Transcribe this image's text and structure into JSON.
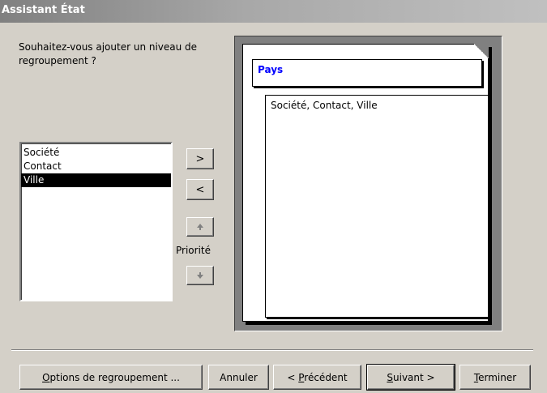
{
  "window": {
    "title": "Assistant État"
  },
  "prompt": {
    "text": "Souhaitez-vous ajouter un niveau de regroupement ?"
  },
  "fields_list": {
    "items": [
      {
        "label": "Société",
        "selected": false
      },
      {
        "label": "Contact",
        "selected": false
      },
      {
        "label": "Ville",
        "selected": true
      }
    ]
  },
  "move_buttons": {
    "add_label": ">",
    "remove_label": "<"
  },
  "priority": {
    "label": "Priorité",
    "up_icon": "arrow-up-icon",
    "down_icon": "arrow-down-icon"
  },
  "preview": {
    "group_header": "Pays",
    "detail_text": "Société, Contact, Ville"
  },
  "footer": {
    "options_button": {
      "mnemonic": "O",
      "rest": "ptions de regroupement ..."
    },
    "cancel_button": {
      "label": "Annuler"
    },
    "back_button": {
      "prefix": "< ",
      "mnemonic": "P",
      "rest": "récédent"
    },
    "next_button": {
      "mnemonic": "S",
      "rest": "uivant >"
    },
    "finish_button": {
      "mnemonic": "T",
      "rest": "erminer"
    }
  }
}
